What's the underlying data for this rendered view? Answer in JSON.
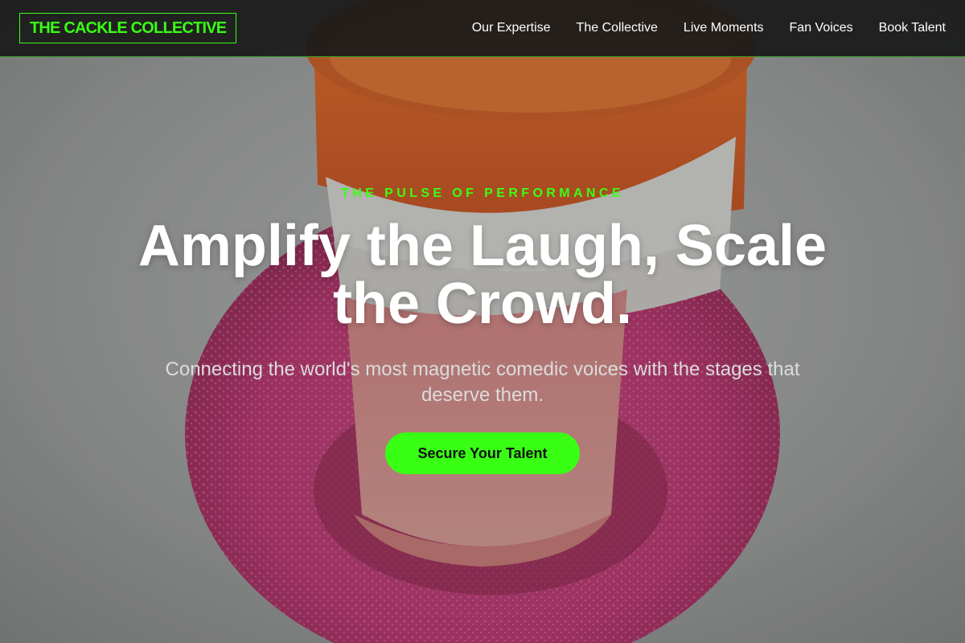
{
  "nav": {
    "logo": "THE CACKLE COLLECTIVE",
    "links": [
      "Our Expertise",
      "The Collective",
      "Live Moments",
      "Fan Voices",
      "Book Talent"
    ]
  },
  "hero": {
    "eyebrow": "THE PULSE OF PERFORMANCE",
    "headline": "Amplify the Laugh, Scale the Crowd.",
    "subheadline": "Connecting the world's most magnetic comedic voices with the stages that deserve them.",
    "cta_label": "Secure Your Talent"
  },
  "colors": {
    "accent": "#39ff14",
    "nav_background": "#1a1a1a",
    "text": "#ffffff"
  },
  "icons": {
    "hero_image": "wind-up-teeth-image"
  }
}
